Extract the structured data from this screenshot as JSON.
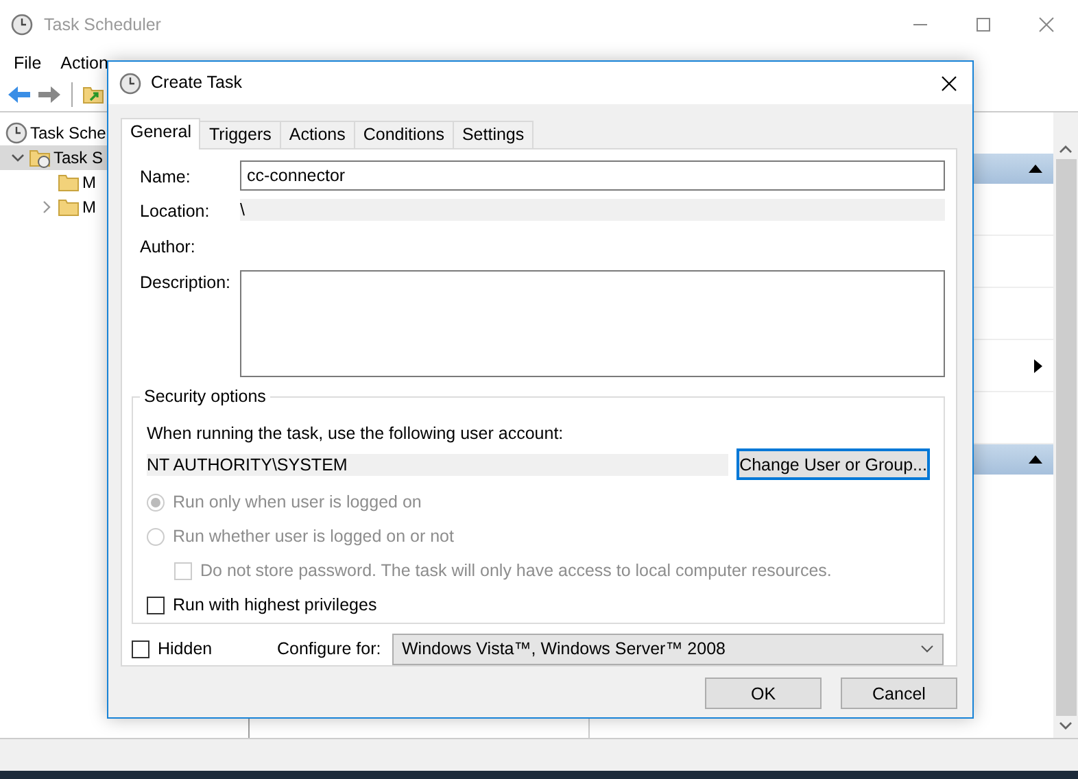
{
  "main_window": {
    "title": "Task Scheduler",
    "menu": [
      "File",
      "Action"
    ],
    "tree": [
      {
        "label": "Task Sche",
        "selected": false,
        "children": [
          {
            "label": "Task S",
            "selected": true,
            "expanded": true,
            "children": [
              {
                "label": "M",
                "selected": false
              },
              {
                "label": "M",
                "selected": false,
                "expanded": false
              }
            ]
          }
        ]
      }
    ]
  },
  "dialog": {
    "title": "Create Task",
    "tabs": [
      {
        "label": "General",
        "selected": true
      },
      {
        "label": "Triggers",
        "selected": false
      },
      {
        "label": "Actions",
        "selected": false
      },
      {
        "label": "Conditions",
        "selected": false
      },
      {
        "label": "Settings",
        "selected": false
      }
    ],
    "name": {
      "label": "Name:",
      "value": "cc-connector"
    },
    "location": {
      "label": "Location:",
      "value": "\\"
    },
    "author": {
      "label": "Author:"
    },
    "description": {
      "label": "Description:"
    },
    "security": {
      "title": "Security options",
      "prompt": "When running the task, use the following user account:",
      "account": "NT AUTHORITY\\SYSTEM",
      "change_button": {
        "label": "Change User or Group...",
        "focused": true
      },
      "options": [
        {
          "kind": "radio",
          "label": "Run only when user is logged on",
          "checked": true,
          "disabled": true
        },
        {
          "kind": "radio",
          "label": "Run whether user is logged on or not",
          "checked": false,
          "disabled": true,
          "children": [
            {
              "kind": "checkbox",
              "label": "Do not store password.  The task will only have access to local computer resources.",
              "checked": false,
              "disabled": true
            }
          ]
        },
        {
          "kind": "checkbox",
          "label": "Run with highest privileges",
          "checked": false,
          "disabled": false
        }
      ]
    },
    "hidden": {
      "label": "Hidden",
      "checked": false
    },
    "configure": {
      "label": "Configure for:",
      "value": "Windows Vista™, Windows Server™ 2008"
    },
    "buttons": [
      {
        "label": "OK"
      },
      {
        "label": "Cancel"
      }
    ]
  }
}
